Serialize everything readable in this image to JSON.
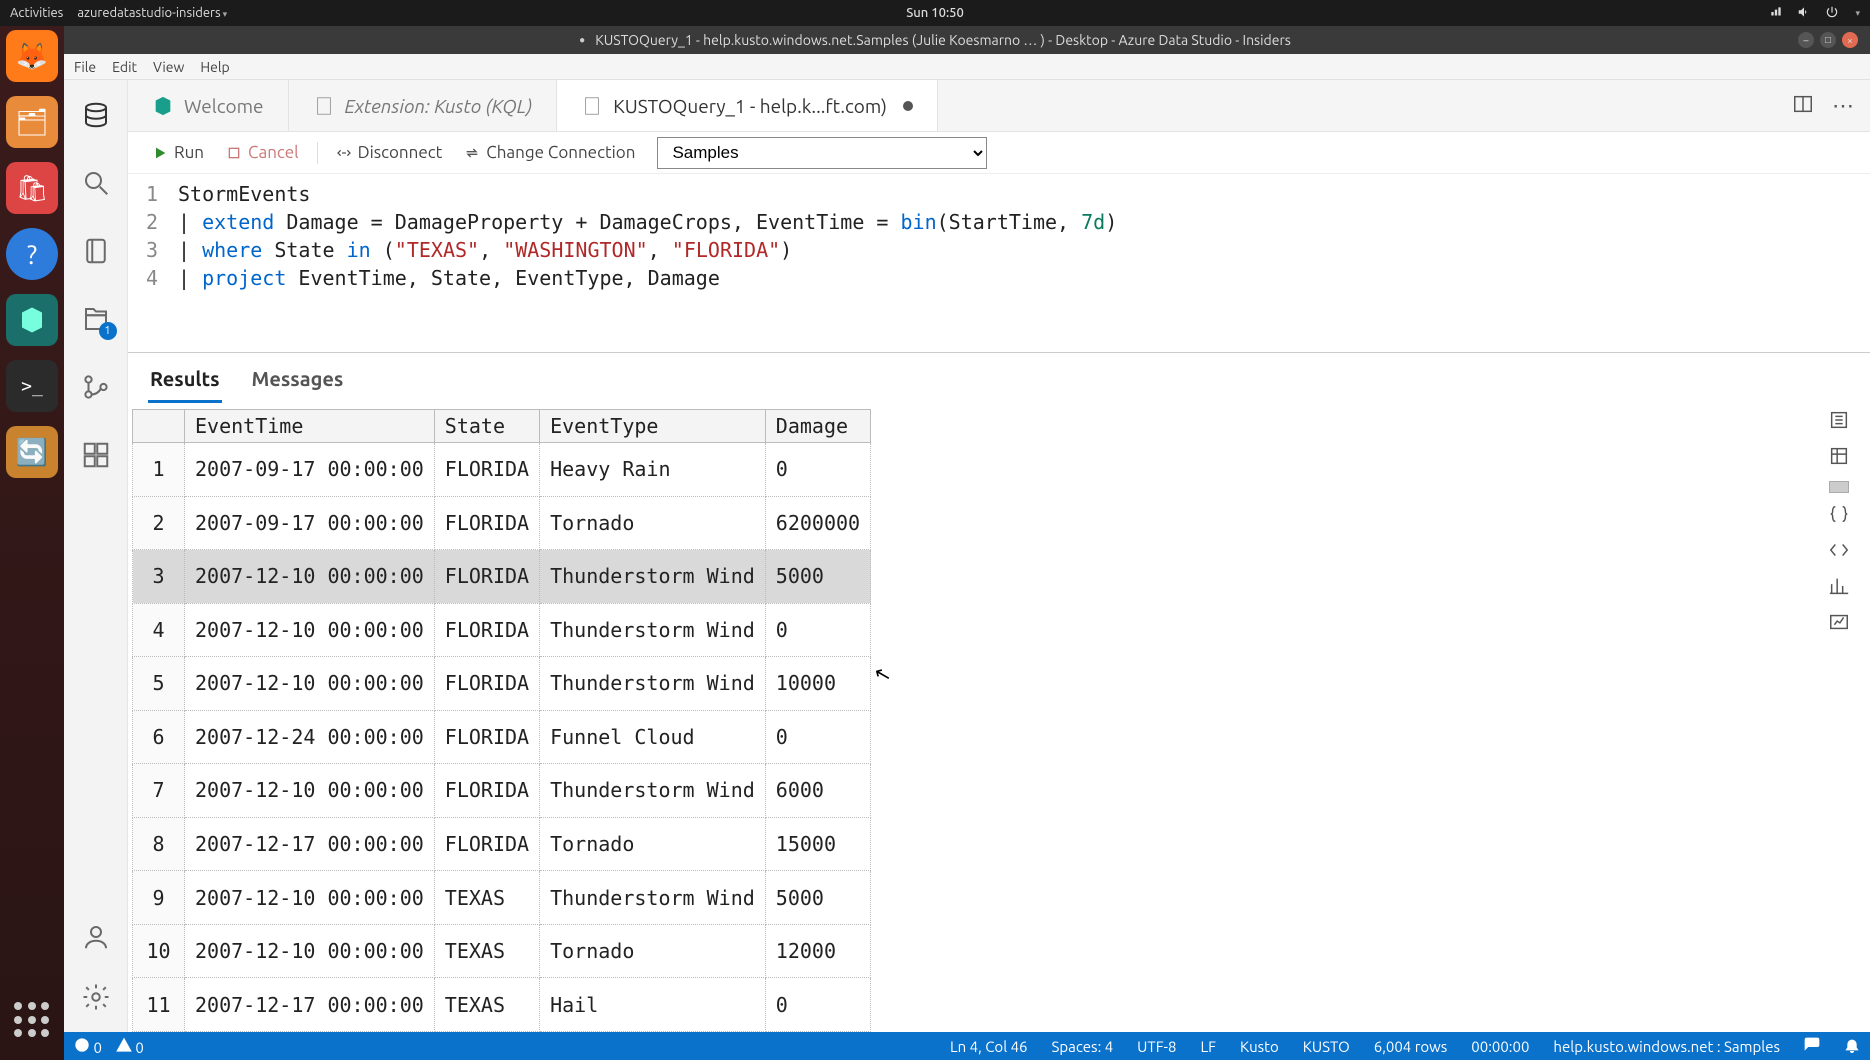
{
  "gnome": {
    "activities": "Activities",
    "app": "azuredatastudio-insiders",
    "clock": "Sun 10:50"
  },
  "window_title": "KUSTOQuery_1 - help.kusto.windows.net.Samples (Julie Koesmarno   …   ) - Desktop - Azure Data Studio - Insiders",
  "menu": {
    "file": "File",
    "edit": "Edit",
    "view": "View",
    "help": "Help"
  },
  "activity_badge": "1",
  "tabs": {
    "welcome": "Welcome",
    "extension": "Extension: Kusto (KQL)",
    "query": "KUSTOQuery_1 - help.k...ft.com)"
  },
  "toolbar": {
    "run": "Run",
    "cancel": "Cancel",
    "disconnect": "Disconnect",
    "change_conn": "Change Connection",
    "database": "Samples"
  },
  "code": {
    "l1": "StormEvents",
    "l2a": "| ",
    "l2b": "extend",
    "l2c": " Damage = DamageProperty + DamageCrops, EventTime = ",
    "l2d": "bin",
    "l2e": "(StartTime, ",
    "l2f": "7d",
    "l2g": ")",
    "l3a": "| ",
    "l3b": "where",
    "l3c": " State ",
    "l3d": "in",
    "l3e": " (",
    "l3f": "\"TEXAS\"",
    "l3g": ", ",
    "l3h": "\"WASHINGTON\"",
    "l3i": ", ",
    "l3j": "\"FLORIDA\"",
    "l3k": ")",
    "l4a": "| ",
    "l4b": "project",
    "l4c": " EventTime, State, EventType, Damage"
  },
  "results": {
    "tab_results": "Results",
    "tab_messages": "Messages",
    "columns": [
      "EventTime",
      "State",
      "EventType",
      "Damage"
    ],
    "rows": [
      {
        "n": "1",
        "t": "2007-09-17 00:00:00",
        "s": "FLORIDA",
        "e": "Heavy Rain",
        "d": "0"
      },
      {
        "n": "2",
        "t": "2007-09-17 00:00:00",
        "s": "FLORIDA",
        "e": "Tornado",
        "d": "6200000"
      },
      {
        "n": "3",
        "t": "2007-12-10 00:00:00",
        "s": "FLORIDA",
        "e": "Thunderstorm Wind",
        "d": "5000"
      },
      {
        "n": "4",
        "t": "2007-12-10 00:00:00",
        "s": "FLORIDA",
        "e": "Thunderstorm Wind",
        "d": "0"
      },
      {
        "n": "5",
        "t": "2007-12-10 00:00:00",
        "s": "FLORIDA",
        "e": "Thunderstorm Wind",
        "d": "10000"
      },
      {
        "n": "6",
        "t": "2007-12-24 00:00:00",
        "s": "FLORIDA",
        "e": "Funnel Cloud",
        "d": "0"
      },
      {
        "n": "7",
        "t": "2007-12-10 00:00:00",
        "s": "FLORIDA",
        "e": "Thunderstorm Wind",
        "d": "6000"
      },
      {
        "n": "8",
        "t": "2007-12-17 00:00:00",
        "s": "FLORIDA",
        "e": "Tornado",
        "d": "15000"
      },
      {
        "n": "9",
        "t": "2007-12-10 00:00:00",
        "s": "TEXAS",
        "e": "Thunderstorm Wind",
        "d": "5000"
      },
      {
        "n": "10",
        "t": "2007-12-10 00:00:00",
        "s": "TEXAS",
        "e": "Tornado",
        "d": "12000"
      },
      {
        "n": "11",
        "t": "2007-12-17 00:00:00",
        "s": "TEXAS",
        "e": "Hail",
        "d": "0"
      }
    ],
    "selected_row": 2
  },
  "status": {
    "errors": "0",
    "warnings": "0",
    "cursor": "Ln 4, Col 46",
    "spaces": "Spaces: 4",
    "encoding": "UTF-8",
    "eol": "LF",
    "lang": "Kusto",
    "mode": "KUSTO",
    "rows": "6,004 rows",
    "elapsed": "00:00:00",
    "conn": "help.kusto.windows.net : Samples"
  }
}
